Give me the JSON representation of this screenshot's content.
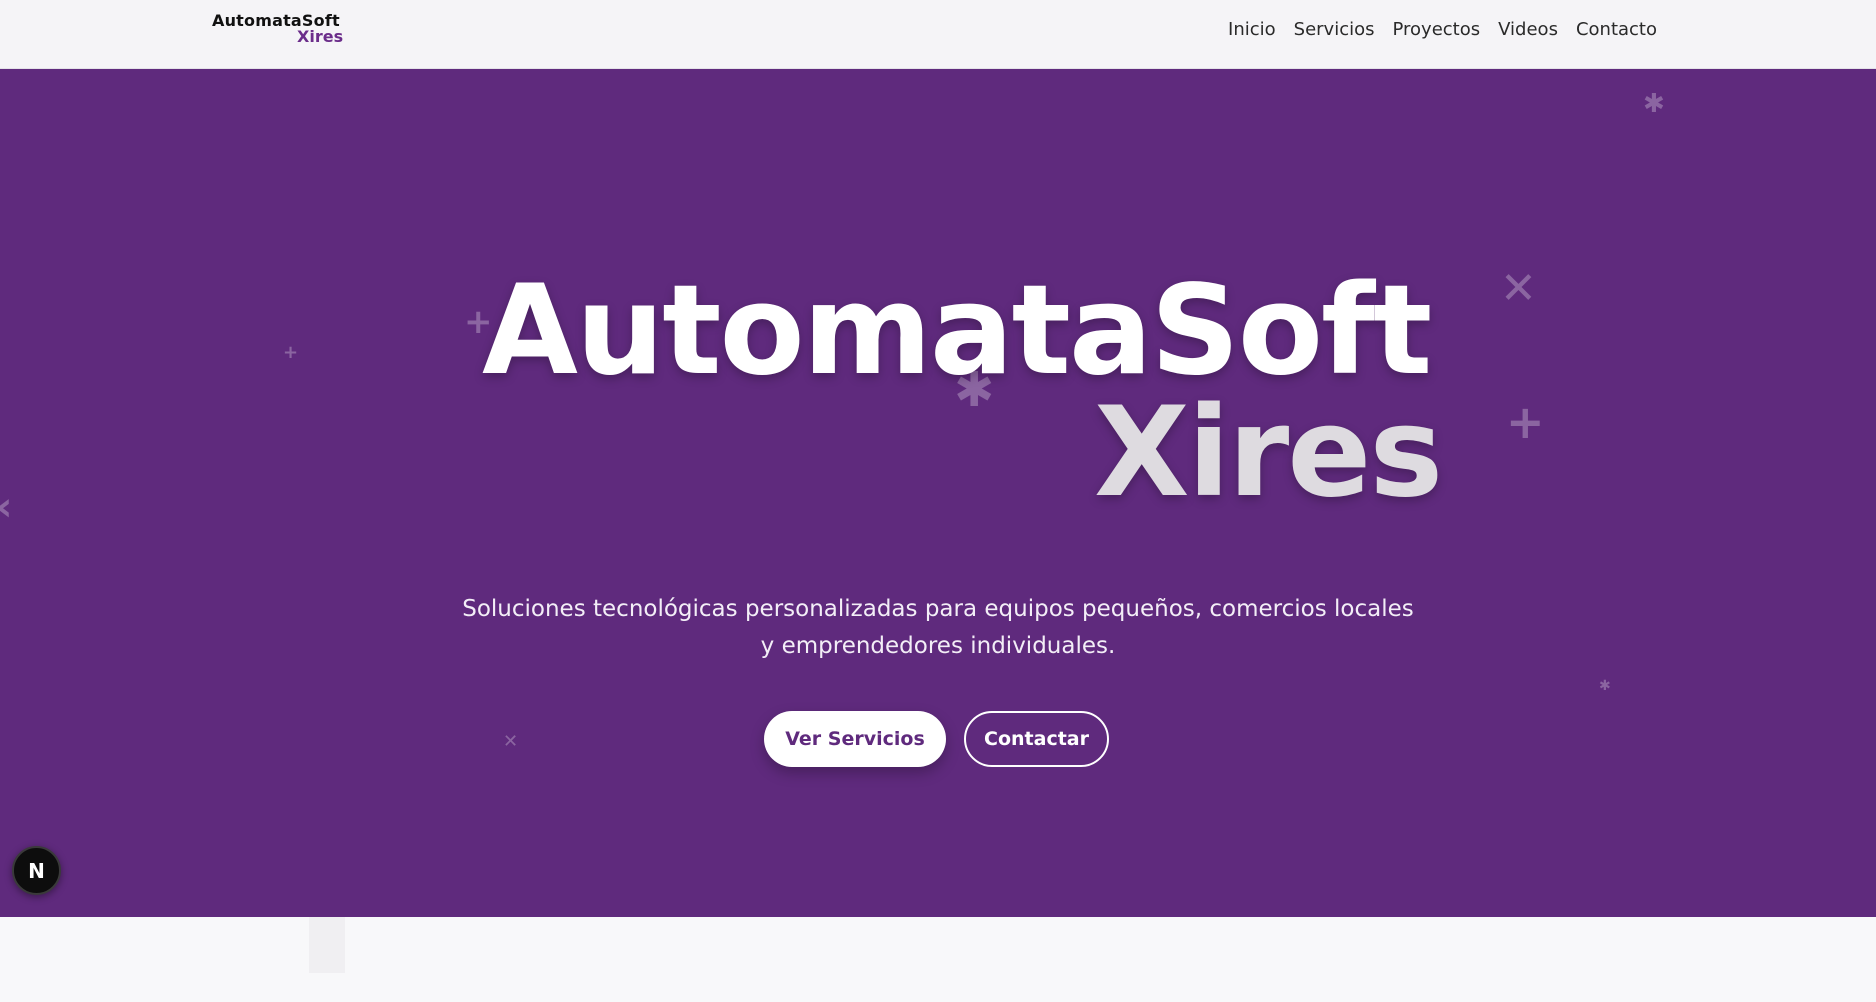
{
  "header": {
    "logo": {
      "top": "AutomataSoft",
      "bottom": "Xires"
    },
    "nav": [
      {
        "label": "Inicio"
      },
      {
        "label": "Servicios"
      },
      {
        "label": "Proyectos"
      },
      {
        "label": "Videos"
      },
      {
        "label": "Contacto"
      }
    ]
  },
  "hero": {
    "title_main": "AutomataSoft",
    "title_sub": "Xires",
    "subtitle": "Soluciones tecnológicas personalizadas para equipos pequeños, comercios locales y emprendedores individuales.",
    "buttons": {
      "primary": "Ver Servicios",
      "secondary": "Contactar"
    }
  },
  "badge": {
    "label": "N"
  },
  "colors": {
    "hero_bg": "#5f2a7d",
    "brand_purple": "#6b2d8a",
    "header_bg": "#f5f4f7",
    "page_bg": "#f8f8fa"
  },
  "icons": [
    "next-logo-icon",
    "decorative-asterisk-icon",
    "decorative-plus-icon",
    "decorative-cross-icon"
  ]
}
